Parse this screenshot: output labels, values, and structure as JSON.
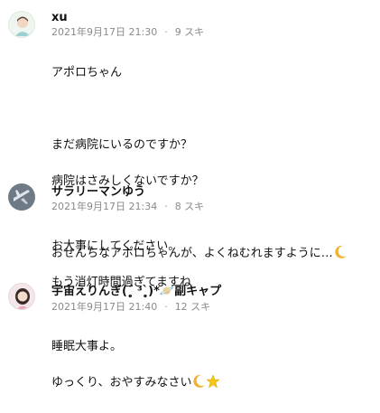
{
  "comments": [
    {
      "name": "xu",
      "date": "2021年9月17日 21:30",
      "likes": "9 スキ",
      "lines": [
        "アポロちゃん",
        "",
        "まだ病院にいるのですか？",
        "病院はさみしくないですか？",
        "",
        "おせんちなアポロちゃんが、よくねむれますように…"
      ]
    },
    {
      "name": "サラリーマンゆう",
      "date": "2021年9月17日 21:34",
      "likes": "8 スキ",
      "lines": [
        "お大事にしてください。",
        "もう消灯時間過ぎてますね"
      ]
    },
    {
      "name": "宇宙えりんぎ(ˊ̥̥̥̥̥ ³ˋ̥̥̥̥̥)*🪐副キャプ",
      "date": "2021年9月17日 21:40",
      "likes": "12 スキ",
      "lines": [
        "睡眠大事よ。",
        "ゆっくり、おやすみなさい"
      ]
    }
  ],
  "icons": {
    "moon": "crescent-moon-icon",
    "star": "star-icon",
    "planet": "planet-icon"
  }
}
